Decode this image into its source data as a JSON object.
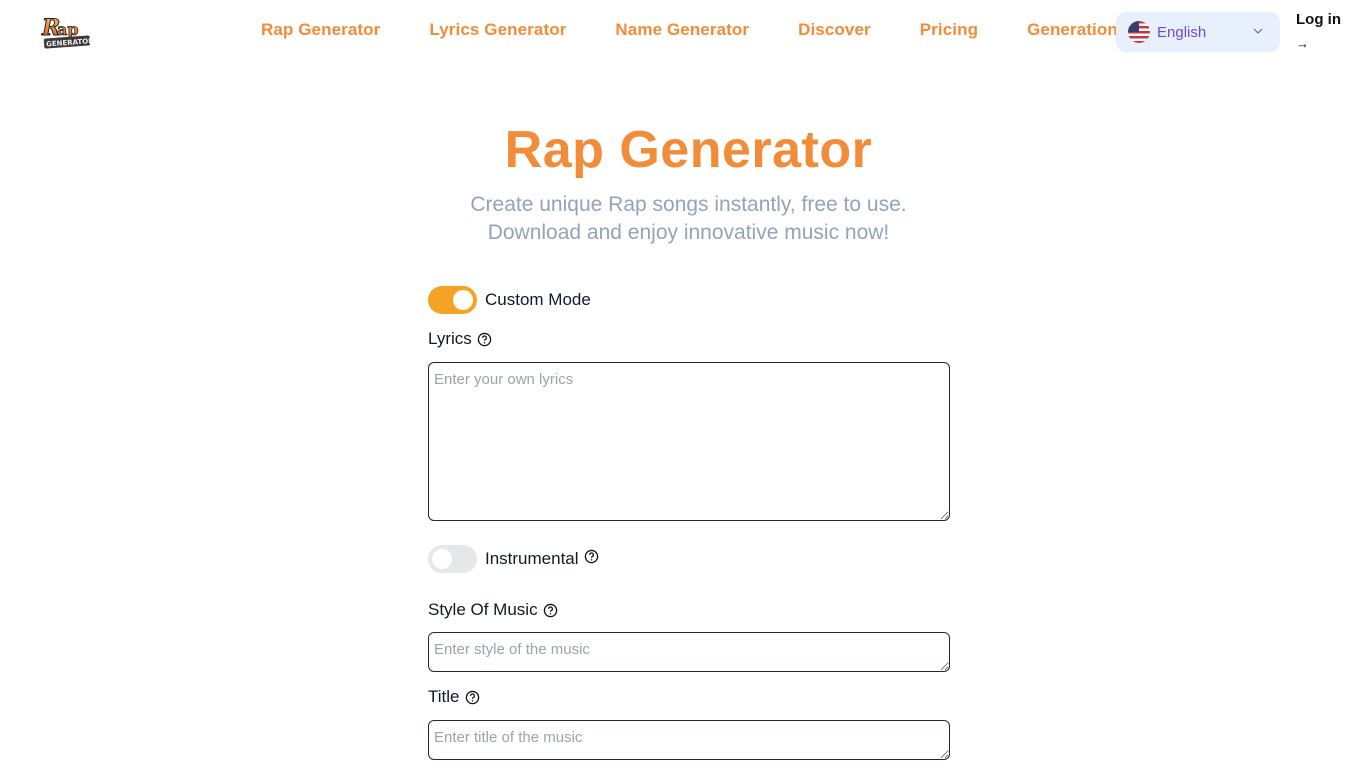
{
  "header": {
    "logo_alt": "Rap Generator",
    "nav": [
      {
        "label": "Rap Generator"
      },
      {
        "label": "Lyrics Generator"
      },
      {
        "label": "Name Generator"
      },
      {
        "label": "Discover"
      },
      {
        "label": "Pricing"
      },
      {
        "label": "Generation"
      }
    ],
    "language": {
      "selected": "English",
      "flag_icon": "us-flag-icon"
    },
    "login": {
      "label": "Log in",
      "arrow": "→"
    }
  },
  "hero": {
    "title": "Rap Generator",
    "subtitle_line1": "Create unique Rap songs instantly, free to use.",
    "subtitle_line2": "Download and enjoy innovative music now!"
  },
  "form": {
    "custom_mode": {
      "label": "Custom Mode",
      "on": true
    },
    "lyrics": {
      "label": "Lyrics",
      "placeholder": "Enter your own lyrics",
      "value": ""
    },
    "instrumental": {
      "label": "Instrumental",
      "on": false
    },
    "style": {
      "label": "Style Of Music",
      "placeholder": "Enter style of the music",
      "value": ""
    },
    "title": {
      "label": "Title",
      "placeholder": "Enter title of the music",
      "value": ""
    }
  },
  "colors": {
    "accent": "#f28c38",
    "toggle_on": "#f5a324",
    "language_bg": "#e8effd",
    "language_text": "#6d4bd8",
    "subtitle": "#94a3b8"
  }
}
